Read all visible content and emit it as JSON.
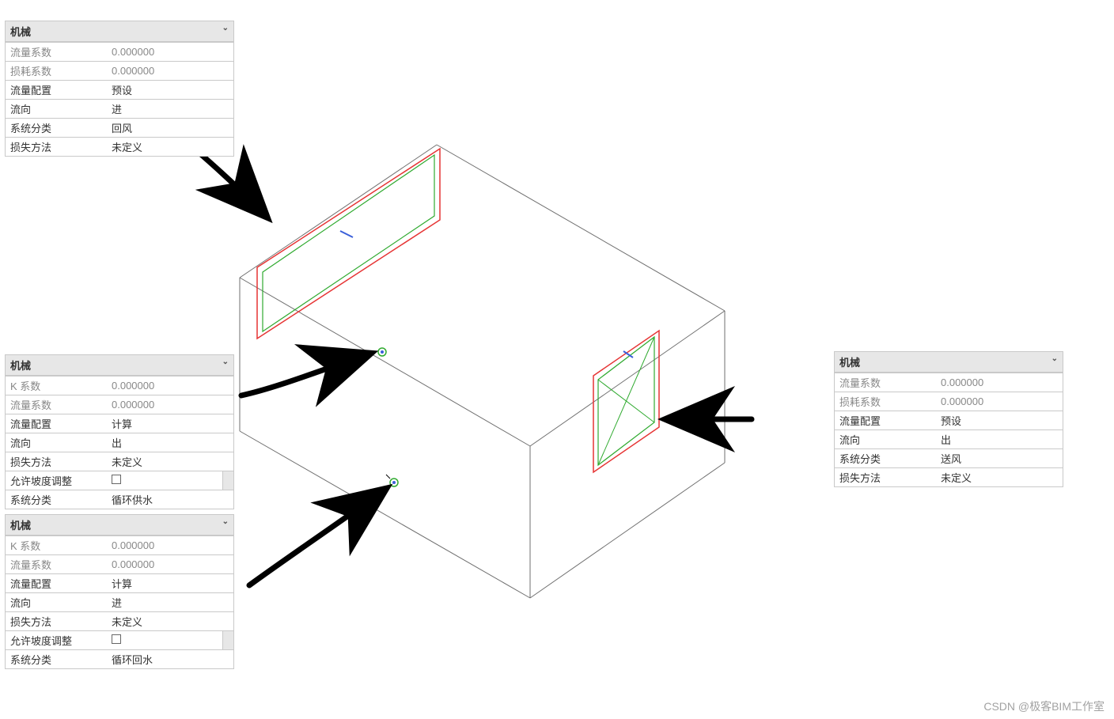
{
  "watermark": "CSDN @极客BIM工作室",
  "panels": {
    "top_left": {
      "header": "机械",
      "rows": [
        {
          "label": "流量系数",
          "value": "0.000000",
          "readonly": true
        },
        {
          "label": "损耗系数",
          "value": "0.000000",
          "readonly": true
        },
        {
          "label": "流量配置",
          "value": "预设"
        },
        {
          "label": "流向",
          "value": "进"
        },
        {
          "label": "系统分类",
          "value": "回风"
        },
        {
          "label": "损失方法",
          "value": "未定义"
        }
      ]
    },
    "mid_left": {
      "header": "机械",
      "rows": [
        {
          "label": "K 系数",
          "value": "0.000000",
          "readonly": true
        },
        {
          "label": "流量系数",
          "value": "0.000000",
          "readonly": true
        },
        {
          "label": "流量配置",
          "value": "计算"
        },
        {
          "label": "流向",
          "value": "出"
        },
        {
          "label": "损失方法",
          "value": "未定义"
        },
        {
          "label": "允许坡度调整",
          "value": "☐",
          "checkbox": true,
          "btn": true
        },
        {
          "label": "系统分类",
          "value": "循环供水"
        }
      ]
    },
    "bottom_left": {
      "header": "机械",
      "rows": [
        {
          "label": "K 系数",
          "value": "0.000000",
          "readonly": true
        },
        {
          "label": "流量系数",
          "value": "0.000000",
          "readonly": true
        },
        {
          "label": "流量配置",
          "value": "计算"
        },
        {
          "label": "流向",
          "value": "进"
        },
        {
          "label": "损失方法",
          "value": "未定义"
        },
        {
          "label": "允许坡度调整",
          "value": "☐",
          "checkbox": true,
          "btn": true
        },
        {
          "label": "系统分类",
          "value": "循环回水"
        }
      ]
    },
    "right": {
      "header": "机械",
      "rows": [
        {
          "label": "流量系数",
          "value": "0.000000",
          "readonly": true
        },
        {
          "label": "损耗系数",
          "value": "0.000000",
          "readonly": true
        },
        {
          "label": "流量配置",
          "value": "预设"
        },
        {
          "label": "流向",
          "value": "出"
        },
        {
          "label": "系统分类",
          "value": "送风"
        },
        {
          "label": "损失方法",
          "value": "未定义"
        }
      ]
    }
  },
  "diagram": {
    "description": "Isometric wireframe box (HVAC equipment) with two duct-connector rectangles (colored red/green outlines) on top and right faces, two small pipe connectors on front face, and four hand-drawn arrows linking property panels to connectors.",
    "colors": {
      "box_edge": "#6f6f6f",
      "rect_outer": "#e63434",
      "rect_inner": "#2faa2f",
      "accent_blue": "#3a5fd9",
      "arrow": "#000000"
    }
  }
}
